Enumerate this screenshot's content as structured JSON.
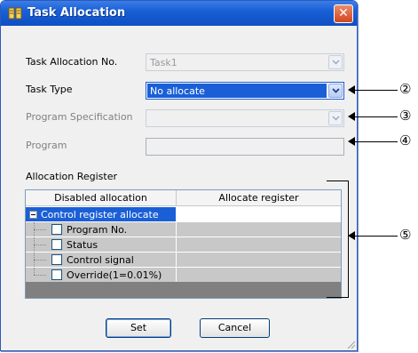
{
  "window": {
    "title": "Task Allocation",
    "close_label": "✕"
  },
  "form": {
    "task_allocation_no": {
      "label": "Task Allocation No.",
      "value": "Task1"
    },
    "task_type": {
      "label": "Task Type",
      "value": "No allocate"
    },
    "program_specification": {
      "label": "Program Specification",
      "value": ""
    },
    "program": {
      "label": "Program",
      "value": ""
    },
    "allocation_register_label": "Allocation Register"
  },
  "grid": {
    "columns": [
      "Disabled allocation",
      "Allocate register"
    ],
    "group_row": "Control register allocate",
    "items": [
      "Program No.",
      "Status",
      "Control signal",
      "Override(1=0.01%)"
    ]
  },
  "buttons": {
    "set": "Set",
    "cancel": "Cancel"
  },
  "callouts": [
    "②",
    "③",
    "④",
    "⑤"
  ],
  "colors": {
    "title_bar": "#1a5fd6",
    "selection": "#1a5fd6",
    "disabled_cell": "#c8c8c8",
    "grid_footer": "#808080"
  }
}
